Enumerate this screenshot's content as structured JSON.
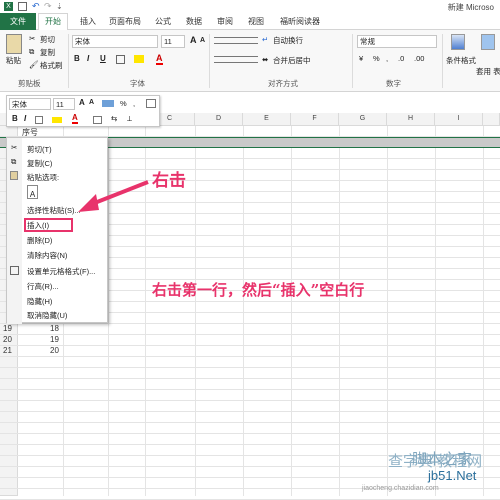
{
  "window": {
    "title": "新建 Microso"
  },
  "tabs": [
    "文件",
    "开始",
    "插入",
    "页面布局",
    "公式",
    "数据",
    "审阅",
    "视图",
    "福昕阅读器"
  ],
  "ribbon": {
    "clipboard": {
      "paste": "粘贴",
      "cut": "剪切",
      "copy": "复制",
      "format_painter": "格式刷",
      "group_label": "剪贴板"
    },
    "font": {
      "name": "宋体",
      "size": "11",
      "group_label": "字体",
      "bold": "B",
      "italic": "I",
      "underline": "U",
      "grow": "A",
      "shrink": "A"
    },
    "alignment": {
      "wrap": "自动换行",
      "merge": "合并后居中",
      "group_label": "对齐方式"
    },
    "number": {
      "format": "常规",
      "group_label": "数字",
      "currency": "¥",
      "percent": "%",
      "comma": ",",
      "inc_dec": ".0",
      "dec_dec": ".00"
    },
    "styles": {
      "conditional": "条件格式",
      "table": "套用 表格格式"
    }
  },
  "mini_toolbar": {
    "font": "宋体",
    "size": "11",
    "percent": "%",
    "comma": ",",
    "bold": "B",
    "italic": "I"
  },
  "sheet": {
    "columns": [
      "C",
      "D",
      "E",
      "F",
      "G",
      "H",
      "I"
    ],
    "a1_value": "序号",
    "rows": [
      {
        "num": "19",
        "value": "18"
      },
      {
        "num": "20",
        "value": "19"
      },
      {
        "num": "21",
        "value": "20"
      }
    ]
  },
  "context_menu": {
    "items": [
      "剪切(T)",
      "复制(C)",
      "粘贴选项:",
      "选择性粘贴(S)...",
      "插入(I)",
      "删除(D)",
      "清除内容(N)",
      "设置单元格格式(F)...",
      "行高(R)...",
      "隐藏(H)",
      "取消隐藏(U)"
    ],
    "paste_icon_label": "A"
  },
  "annotations": {
    "right_click": "右击",
    "instruction": "右击第一行，然后“插入”空白行"
  },
  "watermark": {
    "brand": "脚本之家",
    "site": "jiaocheng.chazidian.com",
    "net": "jb51.Net",
    "cn": "查字典 教程网"
  },
  "colors": {
    "accent": "#217346",
    "highlight": "#e8336b",
    "row_select": "#c9c9c9"
  }
}
